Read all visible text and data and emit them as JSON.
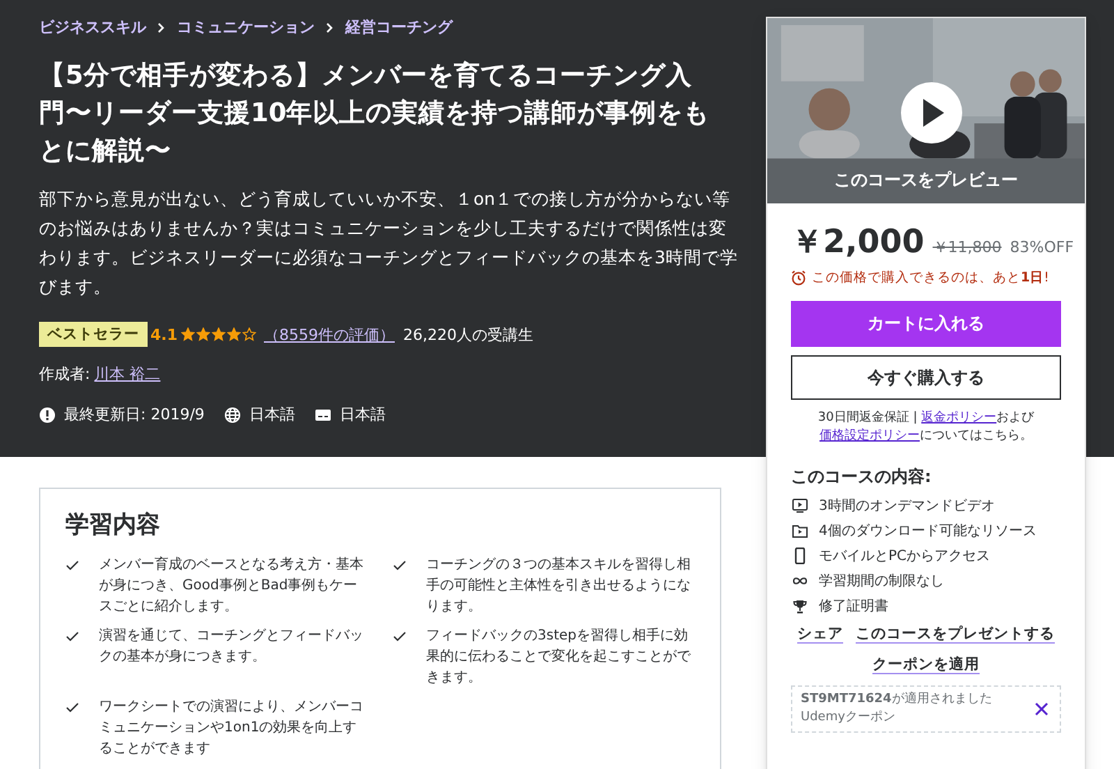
{
  "breadcrumbs": [
    "ビジネススキル",
    "コミュニケーション",
    "経営コーチング"
  ],
  "title": "【5分で相手が変わる】メンバーを育てるコーチング入門〜リーダー支援10年以上の実績を持つ講師が事例をもとに解説〜",
  "description": "部下から意見が出ない、どう育成していいか不安、１on１での接し方が分からない等のお悩みはありませんか？実はコミュニケーションを少し工夫するだけで関係性は変わります。ビジネスリーダーに必須なコーチングとフィードバックの基本を3時間で学びます。",
  "badge": "ベストセラー",
  "rating": "4.1",
  "stars": 4,
  "reviews": "（8559件の評価）",
  "students": "26,220人の受講生",
  "author_label": "作成者:",
  "author": "川本 裕二",
  "meta": [
    {
      "kind": "updated",
      "text": "最終更新日: 2019/9"
    },
    {
      "kind": "language",
      "text": "日本語"
    },
    {
      "kind": "captions",
      "text": "日本語"
    }
  ],
  "learning": {
    "title": "学習内容",
    "items": [
      "メンバー育成のベースとなる考え方・基本が身につき、Good事例とBad事例もケースごとに紹介します。",
      "コーチングの３つの基本スキルを習得し相手の可能性と主体性を引き出せるようになります。",
      "演習を通じて、コーチングとフィードバックの基本が身につきます。",
      "フィードバックの3stepを習得し相手に効果的に伝わることで変化を起こすことができます。",
      "ワークシートでの演習により、メンバーコミュニケーションや1on1の効果を向上することができます"
    ]
  },
  "sidebar": {
    "preview": "このコースをプレビュー",
    "price": "￥2,000",
    "original_price": "￥11,800",
    "discount": "83%OFF",
    "timer": "この価格で購入できるのは、あと**1日**!",
    "cart_button": "カートに入れる",
    "buy_button": "今すぐ購入する",
    "guarantee": [
      {
        "kind": "text",
        "text": "30日間返金保証 | "
      },
      {
        "kind": "link",
        "text": "返金ポリシー"
      },
      {
        "kind": "text",
        "text": "および"
      },
      {
        "kind": "link",
        "text": "価格設定ポリシー"
      },
      {
        "kind": "text",
        "text": "についてはこちら。"
      }
    ],
    "includes_title": "このコースの内容:",
    "includes": [
      {
        "kind": "video",
        "text": "3時間のオンデマンドビデオ"
      },
      {
        "kind": "file",
        "text": "4個のダウンロード可能なリソース"
      },
      {
        "kind": "mobile",
        "text": "モバイルとPCからアクセス"
      },
      {
        "kind": "infinity",
        "text": "学習期間の制限なし"
      },
      {
        "kind": "trophy",
        "text": "修了証明書"
      }
    ],
    "share": "シェア",
    "gift": "このコースをプレゼントする",
    "coupon_link": "クーポンを適用",
    "coupon": {
      "code": "ST9MT71624",
      "applied": "が適用されました",
      "label": "Udemyクーポン"
    }
  }
}
